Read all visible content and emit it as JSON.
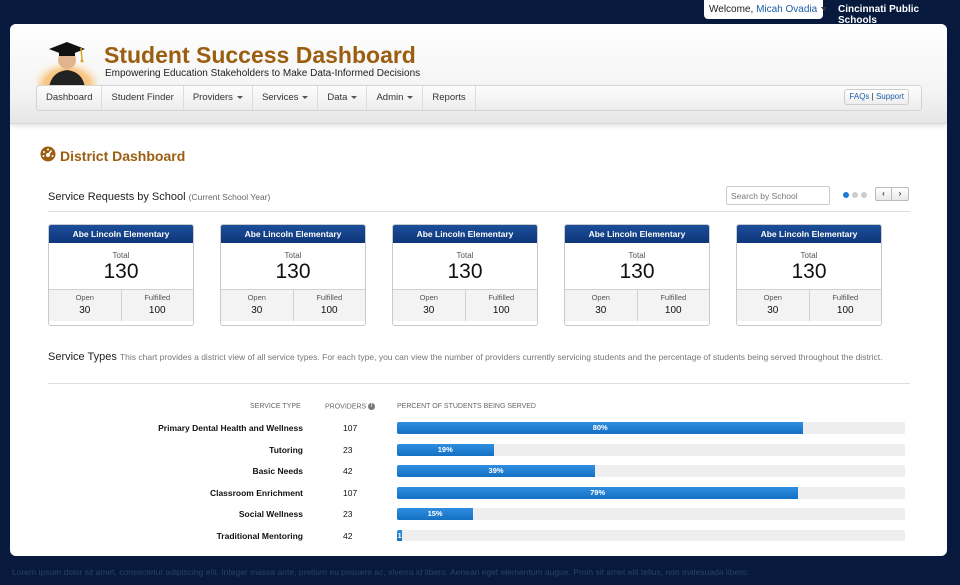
{
  "top": {
    "welcome_label": "Welcome,",
    "user_name": "Micah Ovadia",
    "org_name": "Cincinnati Public Schools"
  },
  "header": {
    "title": "Student Success Dashboard",
    "subtitle": "Empowering Education Stakeholders to Make Data-Informed Decisions",
    "logo_icon": "graduate-cap-icon",
    "colors": {
      "brand": "#9b5e10",
      "navy": "#0e3578",
      "background": "#071a3e"
    }
  },
  "nav": {
    "items": [
      {
        "label": "Dashboard",
        "dropdown": false
      },
      {
        "label": "Student Finder",
        "dropdown": false
      },
      {
        "label": "Providers",
        "dropdown": true
      },
      {
        "label": "Services",
        "dropdown": true
      },
      {
        "label": "Data",
        "dropdown": true
      },
      {
        "label": "Admin",
        "dropdown": true
      },
      {
        "label": "Reports",
        "dropdown": false
      }
    ],
    "faq_label": "FAQs",
    "support_label": "Support"
  },
  "page": {
    "title": "District Dashboard",
    "title_icon": "dashboard-gauge-icon"
  },
  "requests": {
    "title": "Service Requests by School",
    "subtitle": "(Current School Year)",
    "search_placeholder": "Search by School",
    "pager_prev": "‹",
    "pager_next": "›",
    "cards": [
      {
        "school": "Abe Lincoln Elementary",
        "total_label": "Total",
        "total": "130",
        "open_label": "Open",
        "open": "30",
        "fulfilled_label": "Fulfilled",
        "fulfilled": "100"
      },
      {
        "school": "Abe Lincoln Elementary",
        "total_label": "Total",
        "total": "130",
        "open_label": "Open",
        "open": "30",
        "fulfilled_label": "Fulfilled",
        "fulfilled": "100"
      },
      {
        "school": "Abe Lincoln Elementary",
        "total_label": "Total",
        "total": "130",
        "open_label": "Open",
        "open": "30",
        "fulfilled_label": "Fulfilled",
        "fulfilled": "100"
      },
      {
        "school": "Abe Lincoln Elementary",
        "total_label": "Total",
        "total": "130",
        "open_label": "Open",
        "open": "30",
        "fulfilled_label": "Fulfilled",
        "fulfilled": "100"
      },
      {
        "school": "Abe Lincoln Elementary",
        "total_label": "Total",
        "total": "130",
        "open_label": "Open",
        "open": "30",
        "fulfilled_label": "Fulfilled",
        "fulfilled": "100"
      }
    ]
  },
  "types": {
    "title": "Service Types",
    "description": "This chart provides a district view of all service types. For each type, you can view the number of providers currently servicing students and the percentage of students being served throughout the district.",
    "col_service": "SERVICE TYPE",
    "col_providers": "PROVIDERS",
    "col_percent": "PERCENT OF STUDENTS BEING SERVED",
    "rows": [
      {
        "name": "Primary Dental Health and Wellness",
        "providers": "107",
        "percent": 80,
        "percent_label": "80%"
      },
      {
        "name": "Tutoring",
        "providers": "23",
        "percent": 19,
        "percent_label": "19%"
      },
      {
        "name": "Basic Needs",
        "providers": "42",
        "percent": 39,
        "percent_label": "39%"
      },
      {
        "name": "Classroom Enrichment",
        "providers": "107",
        "percent": 79,
        "percent_label": "79%"
      },
      {
        "name": "Social Wellness",
        "providers": "23",
        "percent": 15,
        "percent_label": "15%"
      },
      {
        "name": "Traditional Mentoring",
        "providers": "42",
        "percent": 1,
        "percent_label": "1"
      }
    ]
  },
  "footer": {
    "text": "Lorem ipsum dolor sit amet, consectetur adipiscing elit. Integer massa ante, pretium eu posuere ac, viverra id libero. Aenean eget elementum augue. Proin sit amet elit tellus, non malesuada libero."
  }
}
